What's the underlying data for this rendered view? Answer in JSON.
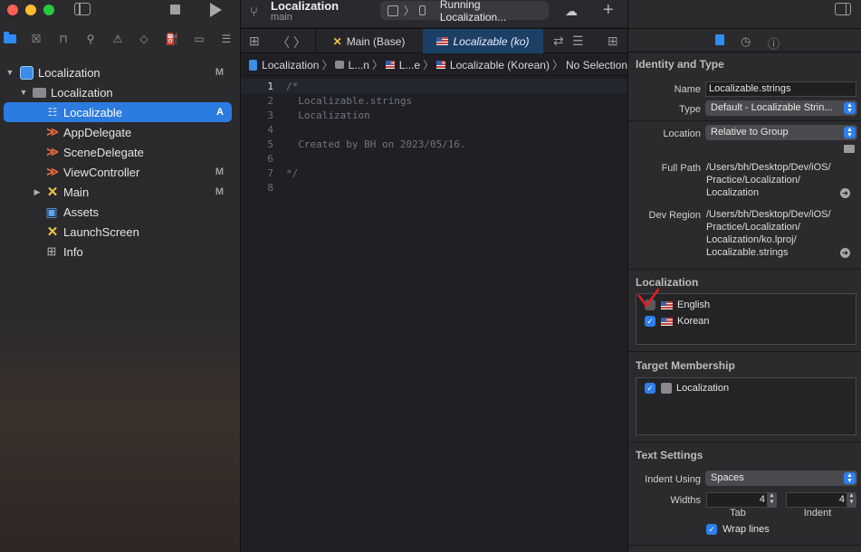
{
  "navigator": {
    "tree": [
      {
        "label": "Localization",
        "badge": "M",
        "icon": "project-icon"
      },
      {
        "label": "Localization",
        "badge": "",
        "icon": "folder-icon"
      },
      {
        "label": "Localizable",
        "badge": "A",
        "icon": "strings-file-icon"
      },
      {
        "label": "AppDelegate",
        "badge": "",
        "icon": "swift-file-icon"
      },
      {
        "label": "SceneDelegate",
        "badge": "",
        "icon": "swift-file-icon"
      },
      {
        "label": "ViewController",
        "badge": "M",
        "icon": "swift-file-icon"
      },
      {
        "label": "Main",
        "badge": "M",
        "icon": "storyboard-icon"
      },
      {
        "label": "Assets",
        "badge": "",
        "icon": "assets-icon"
      },
      {
        "label": "LaunchScreen",
        "badge": "",
        "icon": "storyboard-icon"
      },
      {
        "label": "Info",
        "badge": "",
        "icon": "plist-icon"
      }
    ]
  },
  "toolbar": {
    "project_title": "Localization",
    "branch": "main",
    "scheme_status": "Running Localization..."
  },
  "tabs": [
    {
      "label": "Main (Base)"
    },
    {
      "label": "Localizable (ko)"
    }
  ],
  "jumpbar": {
    "project": "Localization",
    "folder": "L...n",
    "file_short": "L...e",
    "file": "Localizable (Korean)",
    "selection": "No Selection"
  },
  "code_lines": [
    {
      "num": "1",
      "text": "/*"
    },
    {
      "num": "2",
      "text": "  Localizable.strings"
    },
    {
      "num": "3",
      "text": "  Localization"
    },
    {
      "num": "4",
      "text": ""
    },
    {
      "num": "5",
      "text": "  Created by BH on 2023/05/16."
    },
    {
      "num": "6",
      "text": ""
    },
    {
      "num": "7",
      "text": "*/"
    },
    {
      "num": "8",
      "text": ""
    }
  ],
  "inspector": {
    "identity": {
      "title": "Identity and Type",
      "name_label": "Name",
      "name_value": "Localizable.strings",
      "type_label": "Type",
      "type_value": "Default - Localizable Strin...",
      "location_label": "Location",
      "location_value": "Relative to Group",
      "fullpath_label": "Full Path",
      "fullpath_value": "/Users/bh/Desktop/Dev/iOS/ Practice/Localization/ Localization",
      "devregion_label": "Dev Region",
      "devregion_value": "/Users/bh/Desktop/Dev/iOS/ Practice/Localization/ Localization/ko.lproj/ Localizable.strings"
    },
    "localization": {
      "title": "Localization",
      "items": [
        {
          "label": "English",
          "checked": false
        },
        {
          "label": "Korean",
          "checked": true
        }
      ]
    },
    "membership": {
      "title": "Target Membership",
      "target": "Localization"
    },
    "text_settings": {
      "title": "Text Settings",
      "indent_label": "Indent Using",
      "indent_value": "Spaces",
      "widths_label": "Widths",
      "tab_value": "4",
      "indent_width_value": "4",
      "tab_label": "Tab",
      "indent_sublabel": "Indent",
      "wrap_label": "Wrap lines"
    }
  },
  "colors": {
    "accent": "#2d7ff0",
    "selection": "#2c7be0",
    "annotation": "#e02020"
  }
}
